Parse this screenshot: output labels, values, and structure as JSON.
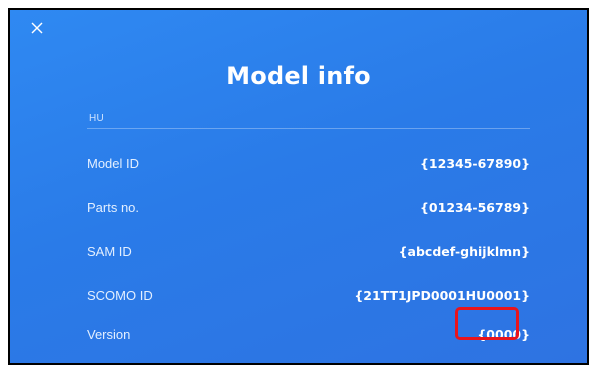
{
  "screen": {
    "title": "Model info",
    "close_icon": "close-icon",
    "section_label": "HU",
    "rows": [
      {
        "label": "Model ID",
        "value": "{12345-67890}"
      },
      {
        "label": "Parts no.",
        "value": "{01234-56789}"
      },
      {
        "label": "SAM ID",
        "value": "{abcdef-ghijklmn}"
      },
      {
        "label": "SCOMO ID",
        "value": "{21TT1JPD0001HU0001}"
      },
      {
        "label": "Version",
        "value": "{0000}"
      }
    ]
  },
  "colors": {
    "background": "#2a7be8",
    "highlight": "#e8141c",
    "text": "#ffffff"
  }
}
